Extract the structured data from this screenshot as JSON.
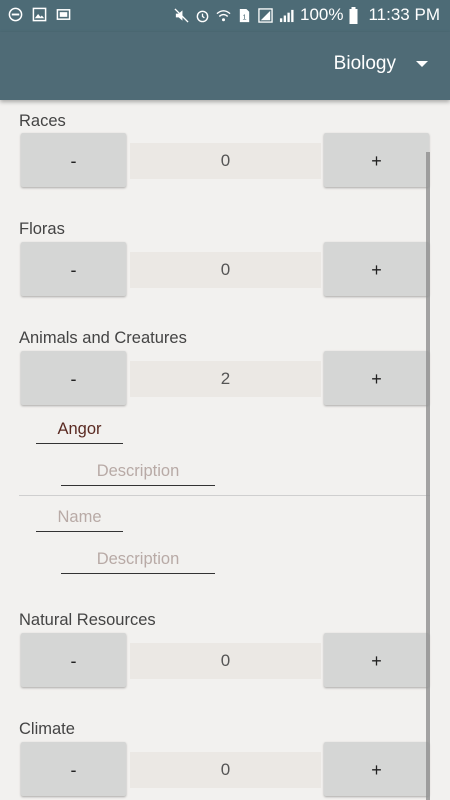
{
  "status_bar": {
    "battery": "100%",
    "time": "11:33 PM"
  },
  "app_bar": {
    "spinner_value": "Biology"
  },
  "sections": {
    "races": {
      "label": "Races",
      "minus": "-",
      "count": "0",
      "plus": "+"
    },
    "floras": {
      "label": "Floras",
      "minus": "-",
      "count": "0",
      "plus": "+"
    },
    "animals": {
      "label": "Animals and Creatures",
      "minus": "-",
      "count": "2",
      "plus": "+"
    },
    "natural_resources": {
      "label": "Natural Resources",
      "minus": "-",
      "count": "0",
      "plus": "+"
    },
    "climate": {
      "label": "Climate",
      "minus": "-",
      "count": "0",
      "plus": "+"
    }
  },
  "animal_entries": [
    {
      "name": "Angor",
      "description_placeholder": "Description"
    },
    {
      "name_placeholder": "Name",
      "description_placeholder": "Description"
    }
  ]
}
